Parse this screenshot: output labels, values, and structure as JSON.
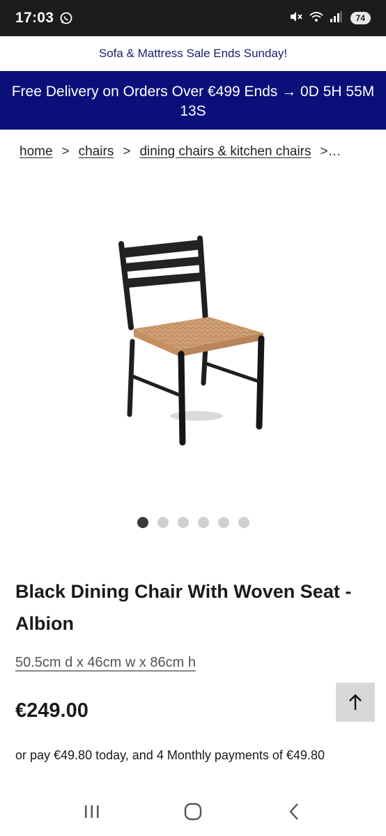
{
  "status_bar": {
    "time": "17:03",
    "battery": "74",
    "icons": [
      "whatsapp-icon",
      "mute-icon",
      "wifi-icon",
      "signal-icon"
    ]
  },
  "promo": {
    "text": "Sofa & Mattress Sale Ends Sunday!"
  },
  "delivery_banner": {
    "text": "Free Delivery on Orders Over €499 Ends → 0D 5H 55M 13S"
  },
  "breadcrumb": {
    "items": [
      "home",
      "chairs",
      "dining chairs & kitchen chairs"
    ],
    "separator": ">",
    "overflow": ">…"
  },
  "product": {
    "image_icon": "chair-image",
    "carousel": {
      "count": 6,
      "active_index": 0
    },
    "title": "Black Dining Chair With Woven Seat - Albion",
    "dimensions": "50.5cm d x 46cm w x 86cm h",
    "price": "€249.00",
    "payment_text": "or pay €49.80 today, and 4 Monthly payments of €49.80"
  },
  "scroll_top": {
    "icon": "arrow-up-icon",
    "glyph": "↑"
  },
  "nav_bar": {
    "icons": [
      "recent-apps-icon",
      "home-icon",
      "back-icon"
    ]
  },
  "colors": {
    "delivery_bg": "#0b0f7a",
    "promo_text": "#1b1d6e",
    "status_bg": "#1c1c1c"
  }
}
